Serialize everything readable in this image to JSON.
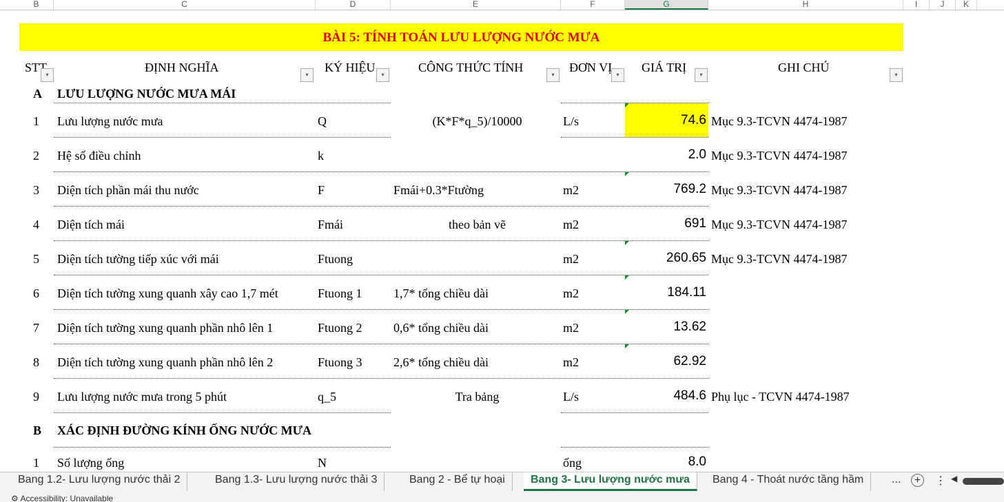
{
  "columns": [
    "B",
    "C",
    "D",
    "E",
    "F",
    "G",
    "H",
    "I",
    "J",
    "K"
  ],
  "title": "BÀI 5: TÍNH TOÁN LƯU LƯỢNG NƯỚC MƯA",
  "headers": {
    "stt": "STT",
    "def": "ĐỊNH NGHĨA",
    "sym": "KÝ HIỆU",
    "formula": "CÔNG THỨC TÍNH",
    "unit": "ĐƠN VỊ",
    "value": "GIÁ TRỊ",
    "note": "GHI CHÚ"
  },
  "filter_icon": "▾",
  "sections": [
    {
      "id": "A",
      "title": "LƯU LƯỢNG NƯỚC MƯA MÁI"
    },
    {
      "id": "B",
      "title": "XÁC ĐỊNH ĐƯỜNG KÍNH ỐNG NƯỚC MƯA"
    }
  ],
  "rows": [
    {
      "stt": "1",
      "def": "Lưu lượng nước mưa",
      "sym": "Q",
      "formula": "(K*F*q_5)/10000",
      "unit": "L/s",
      "value": "74.6",
      "note": "Mục 9.3-TCVN 4474-1987"
    },
    {
      "stt": "2",
      "def": "Hệ số điều chỉnh",
      "sym": "k",
      "formula": "",
      "unit": "",
      "value": "2.0",
      "note": "Mục 9.3-TCVN 4474-1987"
    },
    {
      "stt": "3",
      "def": "Diện tích phần mái thu nước",
      "sym": "F",
      "formula": "Fmái+0.3*Ftường",
      "unit": "m2",
      "value": "769.2",
      "note": "Mục 9.3-TCVN 4474-1987"
    },
    {
      "stt": "4",
      "def": "Diện tích mái",
      "sym": "Fmái",
      "formula": "theo bản vẽ",
      "unit": "m2",
      "value": "691",
      "note": "Mục 9.3-TCVN 4474-1987"
    },
    {
      "stt": "5",
      "def": "Diện tích tường tiếp xúc với mái",
      "sym": "Ftuong",
      "formula": "",
      "unit": "m2",
      "value": "260.65",
      "note": "Mục 9.3-TCVN 4474-1987"
    },
    {
      "stt": "6",
      "def": "Diện tích tường xung quanh xây cao 1,7 mét",
      "sym": "Ftuong 1",
      "formula": "1,7* tổng chiều dài",
      "unit": "m2",
      "value": "184.11",
      "note": ""
    },
    {
      "stt": "7",
      "def": "Diện tích tường xung quanh phần nhô lên 1",
      "sym": "Ftuong 2",
      "formula": "0,6* tổng chiều dài",
      "unit": "m2",
      "value": "13.62",
      "note": ""
    },
    {
      "stt": "8",
      "def": "Diện tích tường xung quanh phần nhô lên 2",
      "sym": "Ftuong 3",
      "formula": "2,6* tổng chiều dài",
      "unit": "m2",
      "value": "62.92",
      "note": ""
    },
    {
      "stt": "9",
      "def": "Lưu lượng nước mưa trong 5 phút",
      "sym": "q_5",
      "formula": "Tra bảng",
      "unit": "L/s",
      "value": "484.6",
      "note": "Phụ lục - TCVN 4474-1987"
    }
  ],
  "rowsB": [
    {
      "stt": "1",
      "def": "Số lượng ống",
      "sym": "N",
      "formula": "",
      "unit": "ống",
      "value": "8.0",
      "note": ""
    }
  ],
  "tabs": [
    "Bang 1.2- Lưu lượng nước thải 2",
    "Bang 1.3- Lưu lượng nước thải 3",
    "Bang 2 - Bể tự hoại",
    "Bang 3- Lưu lượng nước mưa",
    "Bang 4 - Thoát nước tầng hầm"
  ],
  "active_tab": "Bang 3- Lưu lượng nước mưa",
  "more_tabs": "...",
  "status": "Accessibility: Unavailable",
  "colors": {
    "title_bg": "#ffff00",
    "title_text": "#e00000",
    "accent": "#217346"
  }
}
